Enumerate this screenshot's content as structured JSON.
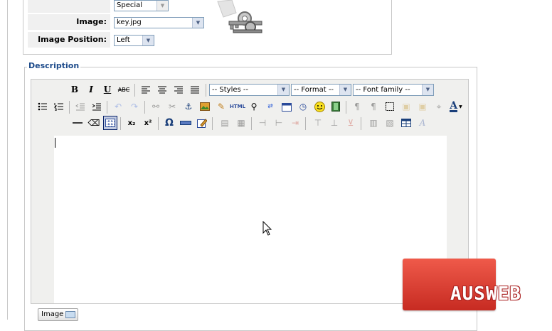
{
  "image_settings": {
    "special_value": "Special",
    "image_label": "Image:",
    "image_value": "key.jpg",
    "image_position_label": "Image Position:",
    "image_position_value": "Left"
  },
  "description": {
    "legend": "Description",
    "toolbar": {
      "styles": "-- Styles --",
      "format": "-- Format --",
      "font_family": "-- Font family --",
      "bold": "B",
      "italic": "I",
      "underline": "U",
      "strike": "ABC",
      "html": "HTML",
      "omega": "Ω"
    },
    "editor_content": ""
  },
  "image_button": {
    "label": "Image"
  },
  "watermark": {
    "text": "AUSWEB",
    "color": "#d9352b"
  }
}
